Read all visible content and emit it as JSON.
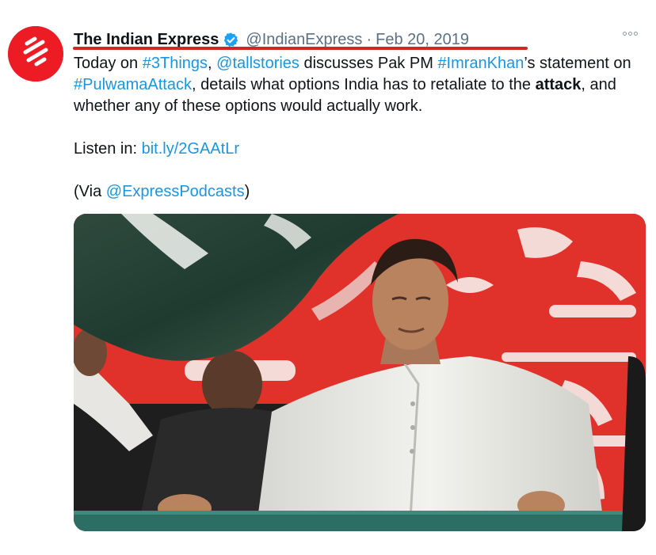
{
  "tweet": {
    "author": {
      "display_name": "The Indian Express",
      "verified": true,
      "handle": "@IndianExpress",
      "avatar_icon": "indian-express-logo-icon",
      "avatar_color": "#ed1c24"
    },
    "separator": "·",
    "date": "Feb 20, 2019",
    "more_icon": "more-options-icon",
    "text": {
      "line1": {
        "t1": "Today on ",
        "hashtag_3things": "#3Things",
        "t2": ", ",
        "mention_tallstories": "@tallstories",
        "t3": " discusses Pak PM ",
        "hashtag_imrankhan": "#ImranKhan",
        "t4": "’s statement on ",
        "hashtag_pulwama": "#PulwamaAttack",
        "t5": ", details what options India has to retaliate to the ",
        "bold_attack": "attack",
        "t6": ", and whether any of these options would actually work."
      },
      "listen_prefix": "Listen in: ",
      "listen_link": "bit.ly/2GAAtLr",
      "via_open": "(Via ",
      "via_mention": "@ExpressPodcasts",
      "via_close": ")"
    },
    "colors": {
      "link": "#1b95e0",
      "secondary_text": "#5b7083",
      "underline_annotation": "#d32626"
    }
  }
}
